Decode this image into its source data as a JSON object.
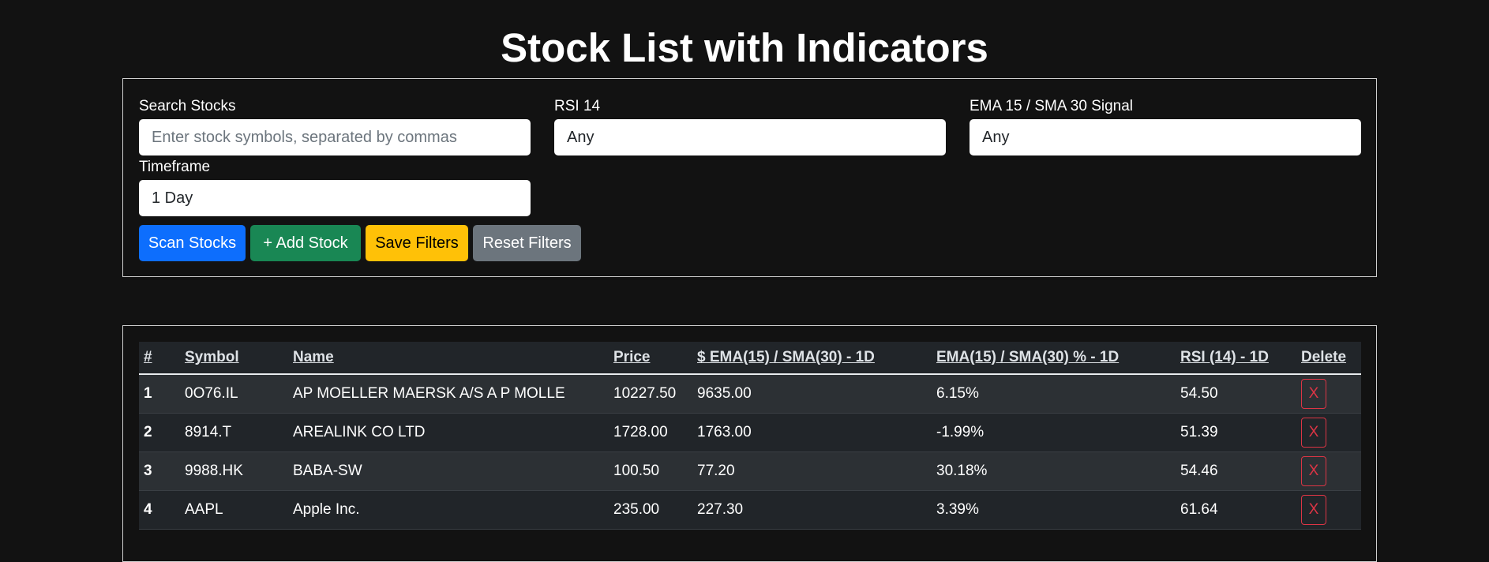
{
  "page": {
    "title": "Stock List with Indicators"
  },
  "filters": {
    "search": {
      "label": "Search Stocks",
      "placeholder": "Enter stock symbols, separated by commas",
      "value": ""
    },
    "rsi": {
      "label": "RSI 14",
      "value": "Any"
    },
    "ema_signal": {
      "label": "EMA 15 / SMA 30 Signal",
      "value": "Any"
    },
    "timeframe": {
      "label": "Timeframe",
      "value": "1 Day"
    }
  },
  "buttons": {
    "scan": "Scan Stocks",
    "add": "+ Add Stock",
    "save": "Save Filters",
    "reset": "Reset Filters"
  },
  "colors": {
    "scan": "#0d6efd",
    "add": "#198754",
    "save": "#ffc107",
    "reset": "#6c757d",
    "delete": "#dc3545"
  },
  "table": {
    "headers": {
      "index": "#",
      "symbol": "Symbol",
      "name": "Name",
      "price": "Price",
      "ema_sma_value": "$ EMA(15) / SMA(30) - 1D",
      "ema_sma_pct": "EMA(15) / SMA(30) % - 1D",
      "rsi": "RSI (14) - 1D",
      "delete": "Delete"
    },
    "rows": [
      {
        "index": "1",
        "symbol": "0O76.IL",
        "name": "AP MOELLER MAERSK A/S A P MOLLE",
        "price": "10227.50",
        "ema_sma_value": "9635.00",
        "ema_sma_pct": "6.15%",
        "rsi": "54.50",
        "delete": "X"
      },
      {
        "index": "2",
        "symbol": "8914.T",
        "name": "AREALINK CO LTD",
        "price": "1728.00",
        "ema_sma_value": "1763.00",
        "ema_sma_pct": "-1.99%",
        "rsi": "51.39",
        "delete": "X"
      },
      {
        "index": "3",
        "symbol": "9988.HK",
        "name": "BABA-SW",
        "price": "100.50",
        "ema_sma_value": "77.20",
        "ema_sma_pct": "30.18%",
        "rsi": "54.46",
        "delete": "X"
      },
      {
        "index": "4",
        "symbol": "AAPL",
        "name": "Apple Inc.",
        "price": "235.00",
        "ema_sma_value": "227.30",
        "ema_sma_pct": "3.39%",
        "rsi": "61.64",
        "delete": "X"
      }
    ]
  }
}
